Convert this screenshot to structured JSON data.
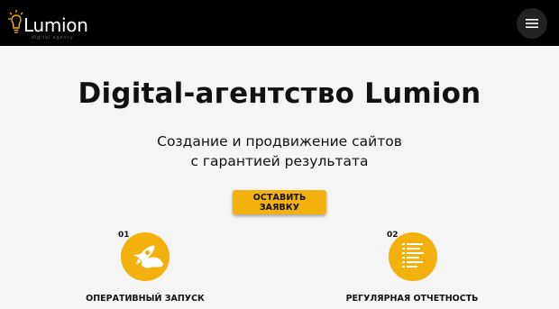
{
  "header": {
    "logo_text": "Lumion",
    "logo_tagline": "digital agency",
    "menu_icon": "hamburger-menu-icon"
  },
  "hero": {
    "title": "Digital-агентство Lumion",
    "subtitle_line1": "Создание и продвижение сайтов",
    "subtitle_line2": "с гарантией результата",
    "cta_label": "ОСТАВИТЬ ЗАЯВКУ"
  },
  "features": [
    {
      "number": "01",
      "icon": "rocket-icon",
      "label": "ОПЕРАТИВНЫЙ ЗАПУСК"
    },
    {
      "number": "02",
      "icon": "document-icon",
      "label": "РЕГУЛЯРНАЯ ОТЧЕТНОСТЬ"
    }
  ],
  "colors": {
    "accent": "#f2b10c",
    "header_bg": "#000000",
    "page_bg": "#f5f5f5"
  }
}
